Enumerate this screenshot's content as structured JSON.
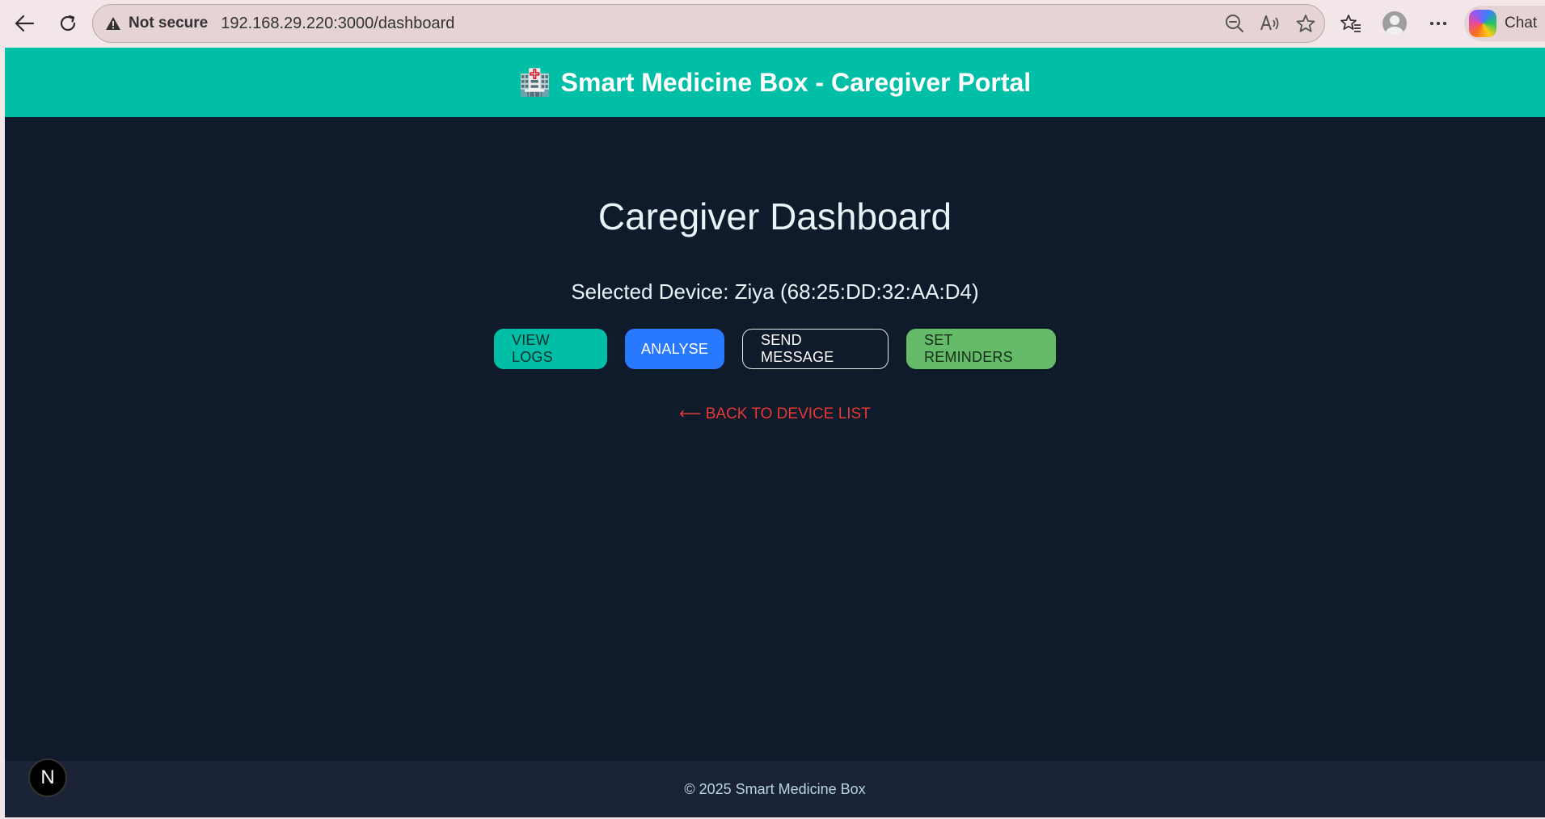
{
  "browser": {
    "not_secure_label": "Not secure",
    "url": "192.168.29.220:3000/dashboard",
    "chat_label": "Chat"
  },
  "header": {
    "icon": "🏥",
    "title": "Smart Medicine Box - Caregiver Portal",
    "accent_color": "#00bfa6"
  },
  "main": {
    "title": "Caregiver Dashboard",
    "selected_device": "Selected Device: Ziya (68:25:DD:32:AA:D4)",
    "buttons": {
      "view_logs": "VIEW LOGS",
      "analyse": "ANALYSE",
      "send_message": "SEND MESSAGE",
      "set_reminders": "SET REMINDERS"
    },
    "back_link": "⟵ BACK TO DEVICE LIST"
  },
  "footer": {
    "text": "© 2025 Smart Medicine Box"
  },
  "dev_badge": {
    "label": "N"
  }
}
